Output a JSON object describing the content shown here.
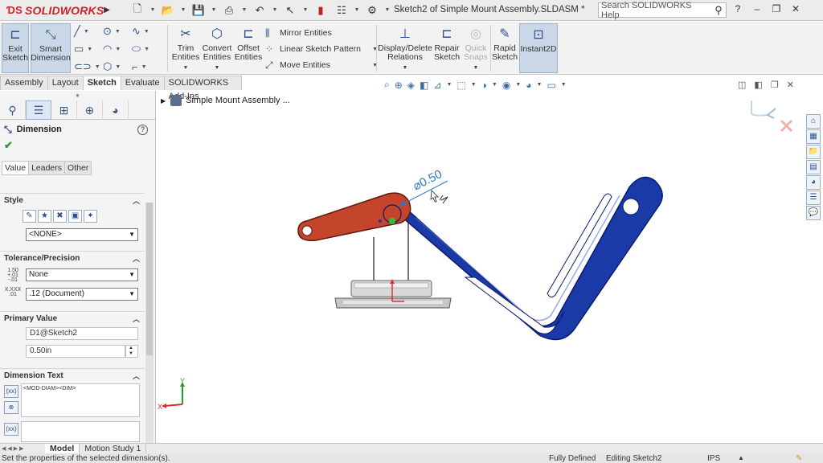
{
  "app": {
    "logo_text": "SOLIDWORKS",
    "logo_ds": "ƊS",
    "window_title": "Sketch2 of Simple Mount Assembly.SLDASM *",
    "search_placeholder": "Search SOLIDWORKS Help"
  },
  "commands": {
    "exit_sketch": "Exit Sketch",
    "smart_dimension": "Smart Dimension",
    "trim_entities": "Trim Entities",
    "convert_entities": "Convert Entities",
    "offset_entities": "Offset Entities",
    "mirror_entities": "Mirror Entities",
    "linear_sketch_pattern": "Linear Sketch Pattern",
    "move_entities": "Move Entities",
    "display_delete_relations": "Display/Delete Relations",
    "repair_sketch": "Repair Sketch",
    "quick_snaps": "Quick Snaps",
    "rapid_sketch": "Rapid Sketch",
    "instant2d": "Instant2D"
  },
  "tabs": [
    "Assembly",
    "Layout",
    "Sketch",
    "Evaluate",
    "SOLIDWORKS Add-Ins"
  ],
  "active_tab": "Sketch",
  "property_manager": {
    "title": "Dimension",
    "subtabs": [
      "Value",
      "Leaders",
      "Other"
    ],
    "style": {
      "title": "Style",
      "favorite": "<NONE>"
    },
    "tolerance": {
      "title": "Tolerance/Precision",
      "tolerance_type": "None",
      "precision": ".12 (Document)",
      "tol_icon_text": "1.50 +.01 -.01",
      "prec_icon_text": "X.XXX .01"
    },
    "primary_value": {
      "title": "Primary Value",
      "name": "D1@Sketch2",
      "value": "0.50in"
    },
    "dimension_text": {
      "title": "Dimension Text",
      "text": "<MOD-DIAM><DIM>"
    }
  },
  "viewport": {
    "tree_root": "Simple Mount Assembly ...",
    "dimension_label": "⌀0.50",
    "axis_x": "X",
    "axis_y": "Y"
  },
  "bottom_tabs": [
    "Model",
    "Motion Study 1"
  ],
  "status": {
    "message": "Set the properties of the selected dimension(s).",
    "state": "Fully Defined",
    "editing": "Editing Sketch2",
    "units": "IPS"
  },
  "colors": {
    "red_link": "#c4452b",
    "blue_link": "#1a3aa8",
    "dim_blue": "#2a78c8"
  }
}
